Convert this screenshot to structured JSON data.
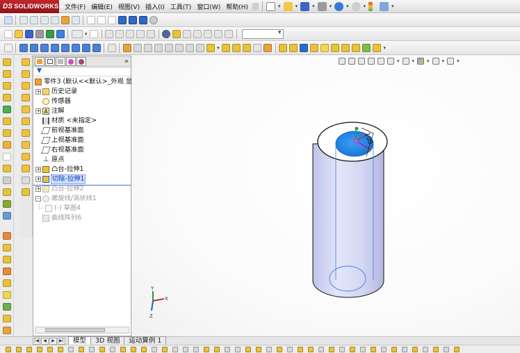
{
  "app": {
    "brand": "SOLIDWORKS",
    "brand_prefix": "DS",
    "menu": [
      "文件(F)",
      "编辑(E)",
      "视图(V)",
      "插入(I)",
      "工具(T)",
      "窗口(W)",
      "帮助(H)"
    ]
  },
  "colors": {
    "brand_red": "#b01c24",
    "selection_bg": "#cfe0ff",
    "cylinder_fill": "#cfd3f4",
    "cut_face": "#1e8fe8",
    "edge_blue": "#3b7fe0"
  },
  "feature_tree": {
    "root": "零件3 (默认<<默认>_外观 显",
    "items": [
      {
        "label": "历史记录",
        "icon": "history-folder-icon",
        "expand": "+",
        "state": "normal"
      },
      {
        "label": "传感器",
        "icon": "sensor-icon",
        "expand": "",
        "state": "normal"
      },
      {
        "label": "注解",
        "icon": "annotation-icon",
        "expand": "+",
        "state": "normal"
      },
      {
        "label": "材质 <未指定>",
        "icon": "material-icon",
        "expand": "",
        "state": "normal"
      },
      {
        "label": "前视基准面",
        "icon": "plane-icon",
        "expand": "",
        "state": "normal"
      },
      {
        "label": "上视基准面",
        "icon": "plane-icon",
        "expand": "",
        "state": "normal"
      },
      {
        "label": "右视基准面",
        "icon": "plane-icon",
        "expand": "",
        "state": "normal"
      },
      {
        "label": "原点",
        "icon": "origin-icon",
        "expand": "",
        "state": "normal"
      },
      {
        "label": "凸台-拉伸1",
        "icon": "boss-extrude-icon",
        "expand": "+",
        "state": "normal"
      },
      {
        "label": "切除-拉伸1",
        "icon": "cut-extrude-icon",
        "expand": "+",
        "state": "selected"
      },
      {
        "label": "凸台-拉伸2",
        "icon": "boss-extrude-icon",
        "expand": "+",
        "state": "dim"
      },
      {
        "label": "螺旋线/涡状线1",
        "icon": "helix-icon",
        "expand": "-",
        "state": "dim"
      },
      {
        "label": "(-) 草图4",
        "icon": "sketch-icon",
        "expand": "",
        "state": "dim"
      },
      {
        "label": "曲线阵列6",
        "icon": "curve-pattern-icon",
        "expand": "",
        "state": "dim"
      }
    ]
  },
  "bottom_tabs": [
    "模型",
    "3D 视图",
    "运动算例 1"
  ],
  "triad": {
    "x": "X",
    "y": "Y",
    "z": "Z"
  }
}
